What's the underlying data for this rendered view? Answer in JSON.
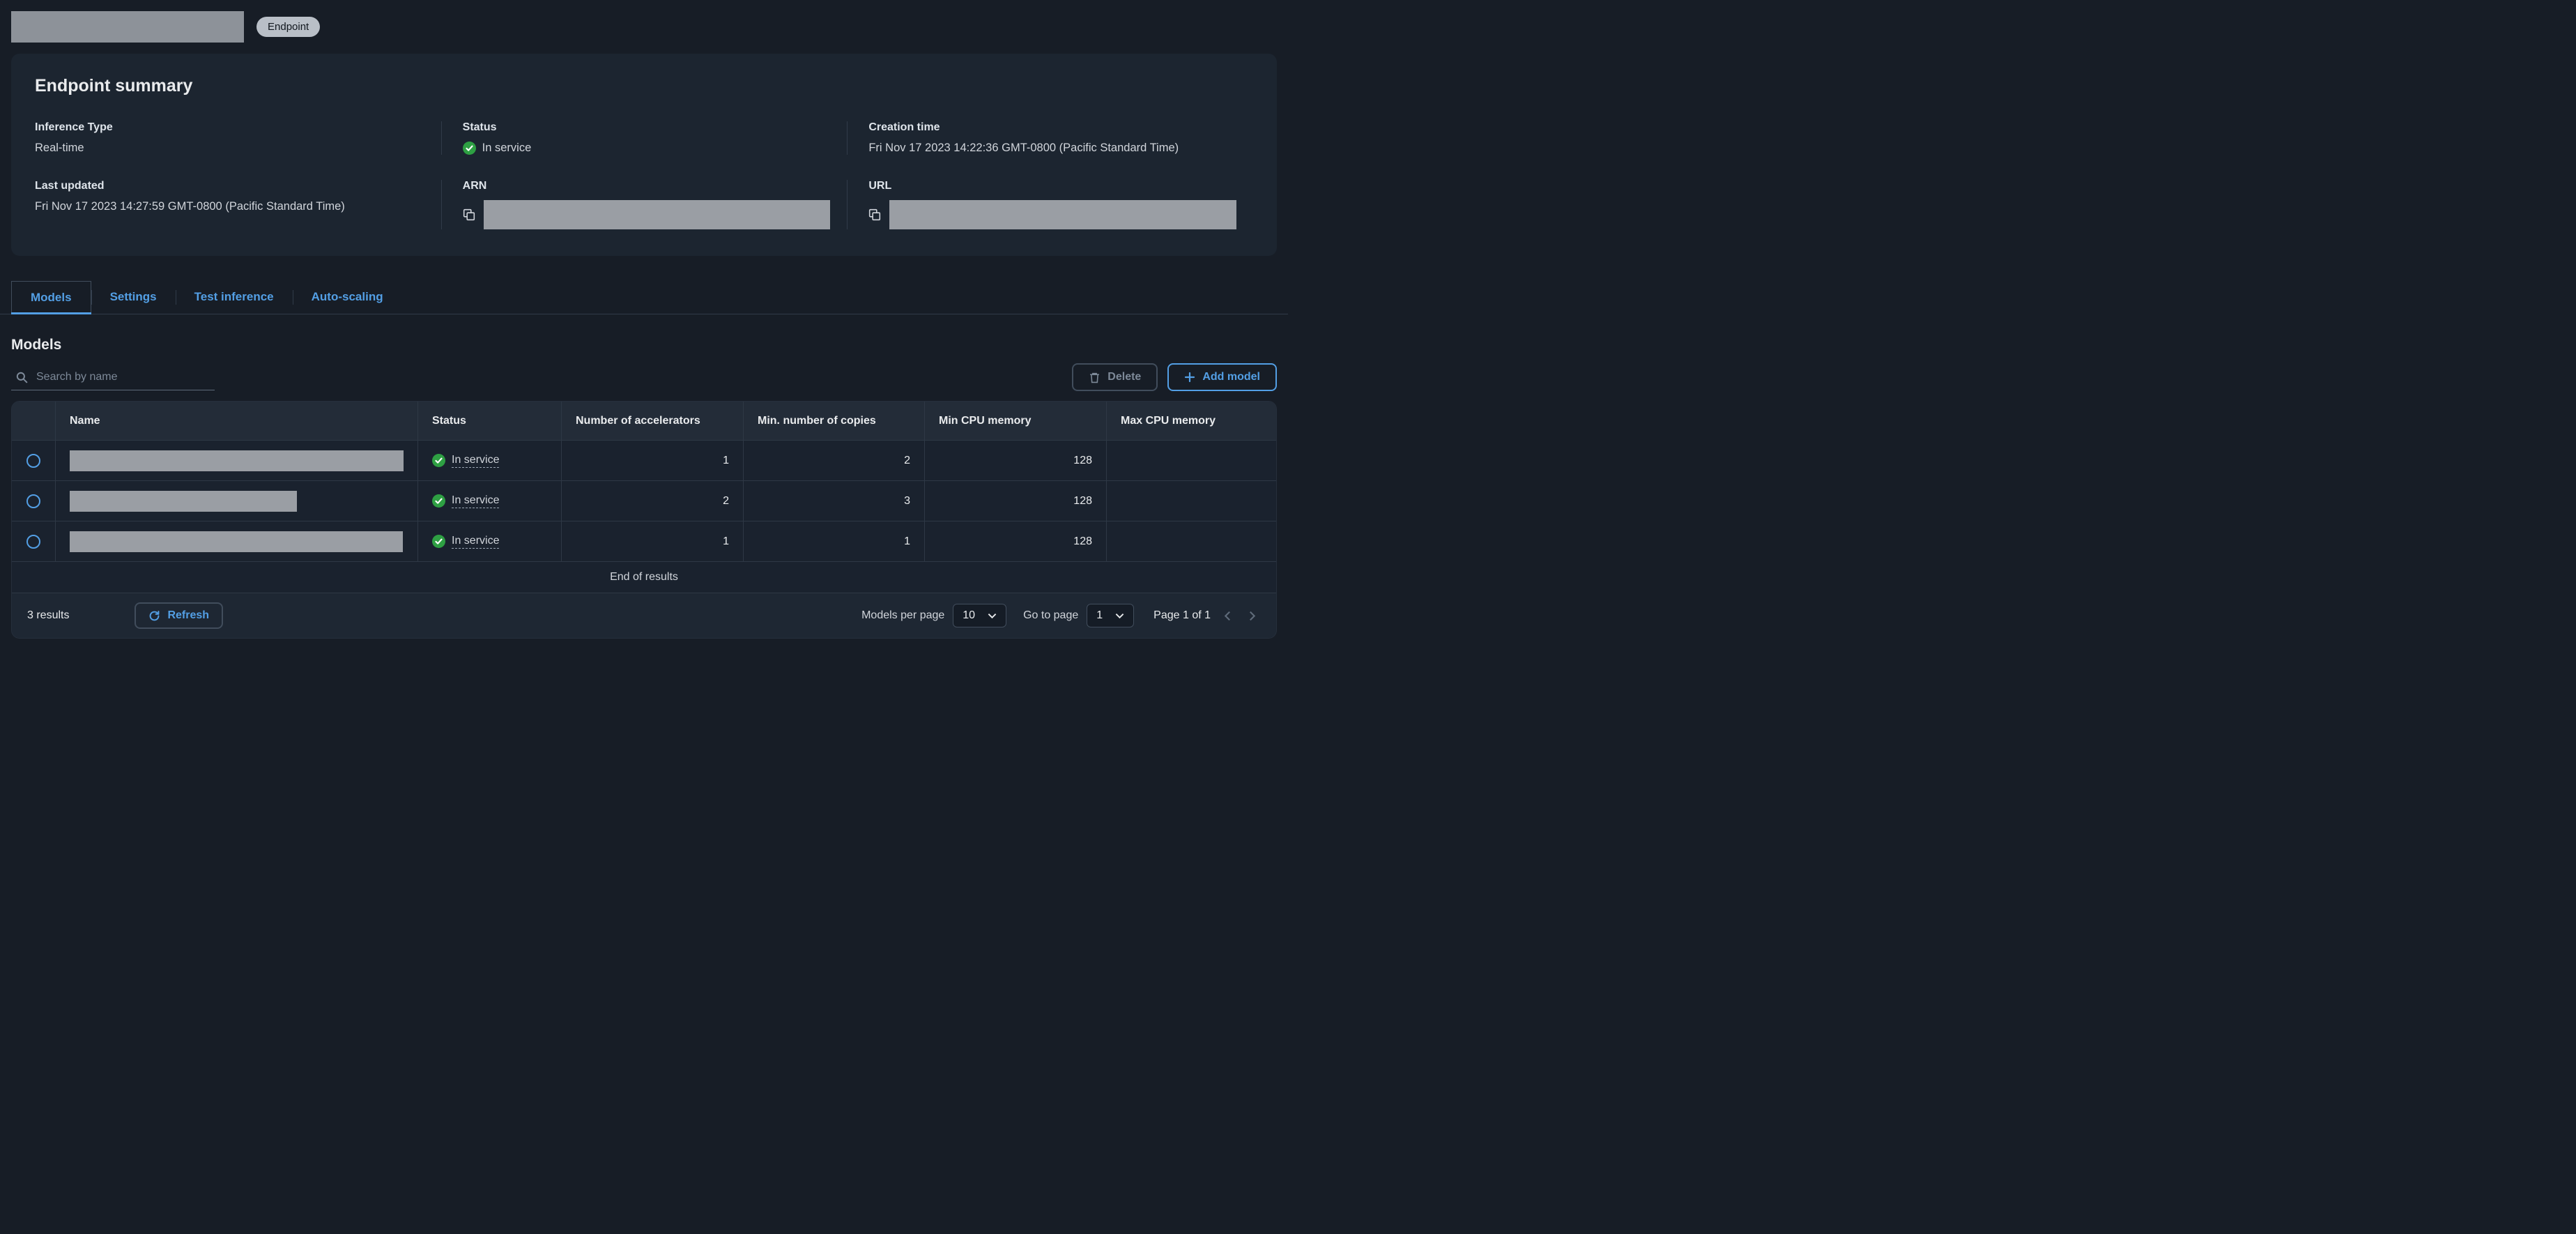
{
  "page": {
    "badge": "Endpoint"
  },
  "colors": {
    "accent": "#539fe5",
    "success": "#2ea043"
  },
  "summary": {
    "title": "Endpoint summary",
    "fields": {
      "inference_type": {
        "label": "Inference Type",
        "value": "Real-time"
      },
      "status": {
        "label": "Status",
        "value": "In service"
      },
      "creation_time": {
        "label": "Creation time",
        "value": "Fri Nov 17 2023 14:22:36 GMT-0800 (Pacific Standard Time)"
      },
      "last_updated": {
        "label": "Last updated",
        "value": "Fri Nov 17 2023 14:27:59 GMT-0800 (Pacific Standard Time)"
      },
      "arn": {
        "label": "ARN"
      },
      "url": {
        "label": "URL"
      }
    }
  },
  "tabs": [
    {
      "label": "Models",
      "active": true
    },
    {
      "label": "Settings",
      "active": false
    },
    {
      "label": "Test inference",
      "active": false
    },
    {
      "label": "Auto-scaling",
      "active": false
    }
  ],
  "models": {
    "title": "Models",
    "search_placeholder": "Search by name",
    "delete_label": "Delete",
    "add_model_label": "Add model",
    "table": {
      "columns": [
        "Name",
        "Status",
        "Number of accelerators",
        "Min. number of copies",
        "Min CPU memory",
        "Max CPU memory"
      ],
      "rows": [
        {
          "status": "In service",
          "accelerators": "1",
          "min_copies": "2",
          "min_cpu": "128",
          "max_cpu": ""
        },
        {
          "status": "In service",
          "accelerators": "2",
          "min_copies": "3",
          "min_cpu": "128",
          "max_cpu": ""
        },
        {
          "status": "In service",
          "accelerators": "1",
          "min_copies": "1",
          "min_cpu": "128",
          "max_cpu": ""
        }
      ],
      "end_of_results": "End of results"
    },
    "footer": {
      "results_count": "3 results",
      "refresh_label": "Refresh",
      "models_per_page_label": "Models per page",
      "models_per_page_value": "10",
      "go_to_page_label": "Go to page",
      "go_to_page_value": "1",
      "page_indicator": "Page 1 of 1"
    }
  }
}
